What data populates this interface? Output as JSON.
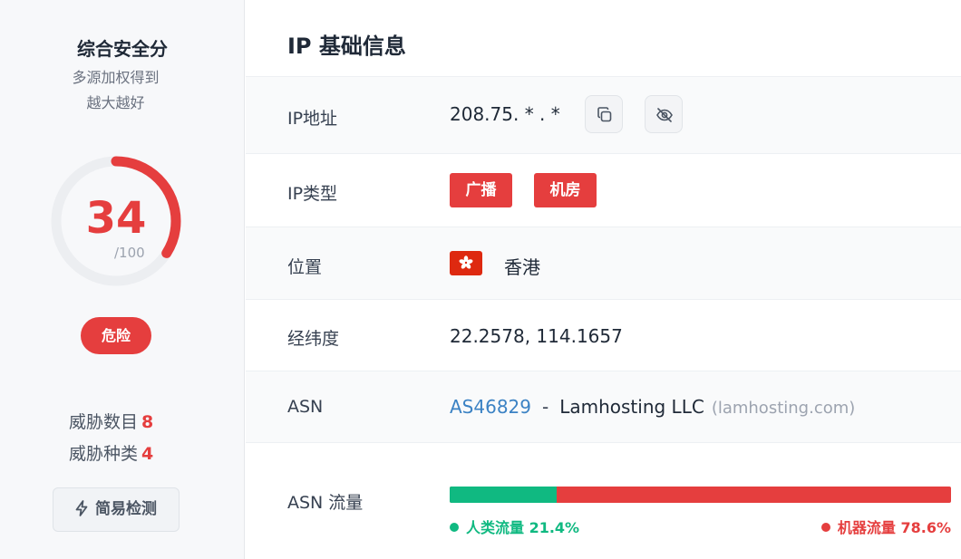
{
  "score_panel": {
    "title": "综合安全分",
    "subtitle_line1": "多源加权得到",
    "subtitle_line2": "越大越好",
    "score": "34",
    "score_value": 34,
    "score_max": "/100",
    "risk_label": "危险",
    "threat_count_label": "威胁数目",
    "threat_count": "8",
    "threat_type_label": "威胁种类",
    "threat_type": "4",
    "quick_check_label": "简易检测",
    "colors": {
      "danger": "#e53e3e",
      "track": "#eceef1"
    }
  },
  "info": {
    "title": "IP 基础信息",
    "ip": {
      "label": "IP地址",
      "value": "208.75. * . *"
    },
    "ip_type": {
      "label": "IP类型",
      "tags": [
        "广播",
        "机房"
      ]
    },
    "location": {
      "label": "位置",
      "value": "香港",
      "flag_icon": "hong-kong-flag-icon"
    },
    "coords": {
      "label": "经纬度",
      "value": "22.2578, 114.1657"
    },
    "asn": {
      "label": "ASN",
      "number": "AS46829",
      "separator": "-",
      "org": "Lamhosting LLC",
      "domain": "(lamhosting.com)"
    },
    "asn_traffic": {
      "label": "ASN 流量",
      "human_label": "人类流量 21.4%",
      "human_pct": 21.4,
      "bot_label": "机器流量 78.6%",
      "bot_pct": 78.6,
      "colors": {
        "human": "#10b981",
        "bot": "#e53e3e"
      }
    }
  },
  "icons": {
    "copy": "copy-icon",
    "hide": "eye-off-icon",
    "quick": "lightning-icon"
  }
}
